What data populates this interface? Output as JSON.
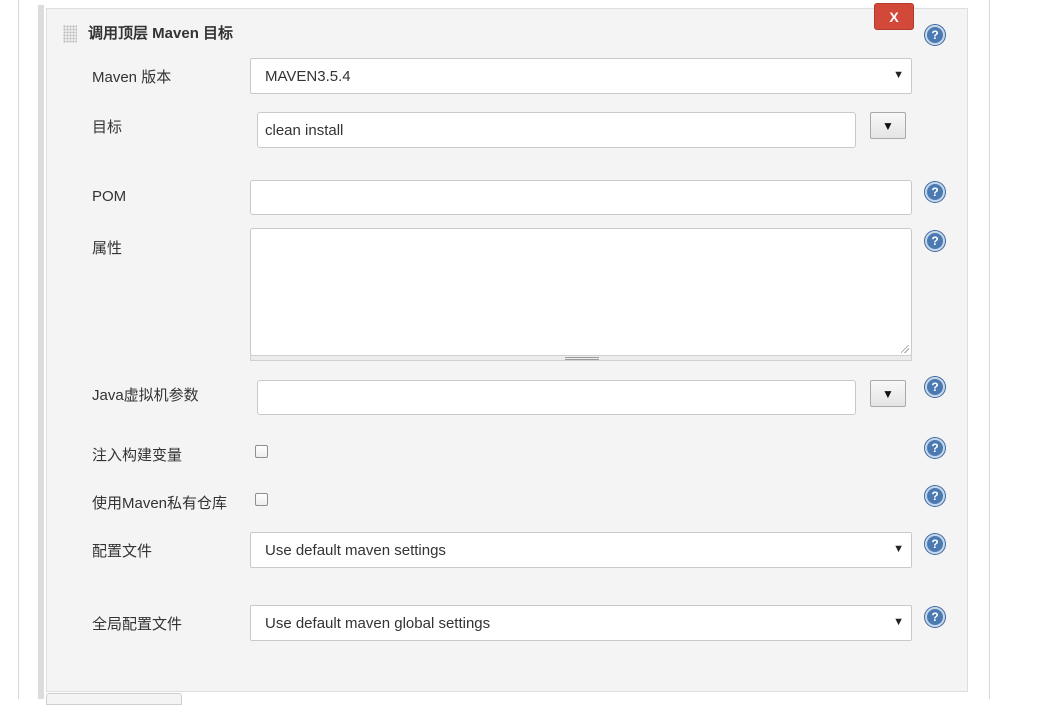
{
  "section": {
    "title": "调用顶层 Maven 目标",
    "delete_label": "X",
    "help_glyph": "?"
  },
  "fields": {
    "maven_version": {
      "label": "Maven 版本",
      "value": "MAVEN3.5.4"
    },
    "goals": {
      "label": "目标",
      "value": "clean install"
    },
    "pom": {
      "label": "POM",
      "value": ""
    },
    "properties": {
      "label": "属性",
      "value": ""
    },
    "jvm_options": {
      "label": "Java虚拟机参数",
      "value": ""
    },
    "inject_build_vars": {
      "label": "注入构建变量",
      "checked": false
    },
    "private_repo": {
      "label": "使用Maven私有仓库",
      "checked": false
    },
    "settings_file": {
      "label": "配置文件",
      "value": "Use default maven settings"
    },
    "global_settings_file": {
      "label": "全局配置文件",
      "value": "Use default maven global settings"
    }
  },
  "icons": {
    "select_arrow": "▼",
    "expand_arrow": "▼"
  },
  "colors": {
    "delete_button": "#d24939",
    "help_icon": "#4b7ab3",
    "panel_background": "#f4f4f4"
  }
}
